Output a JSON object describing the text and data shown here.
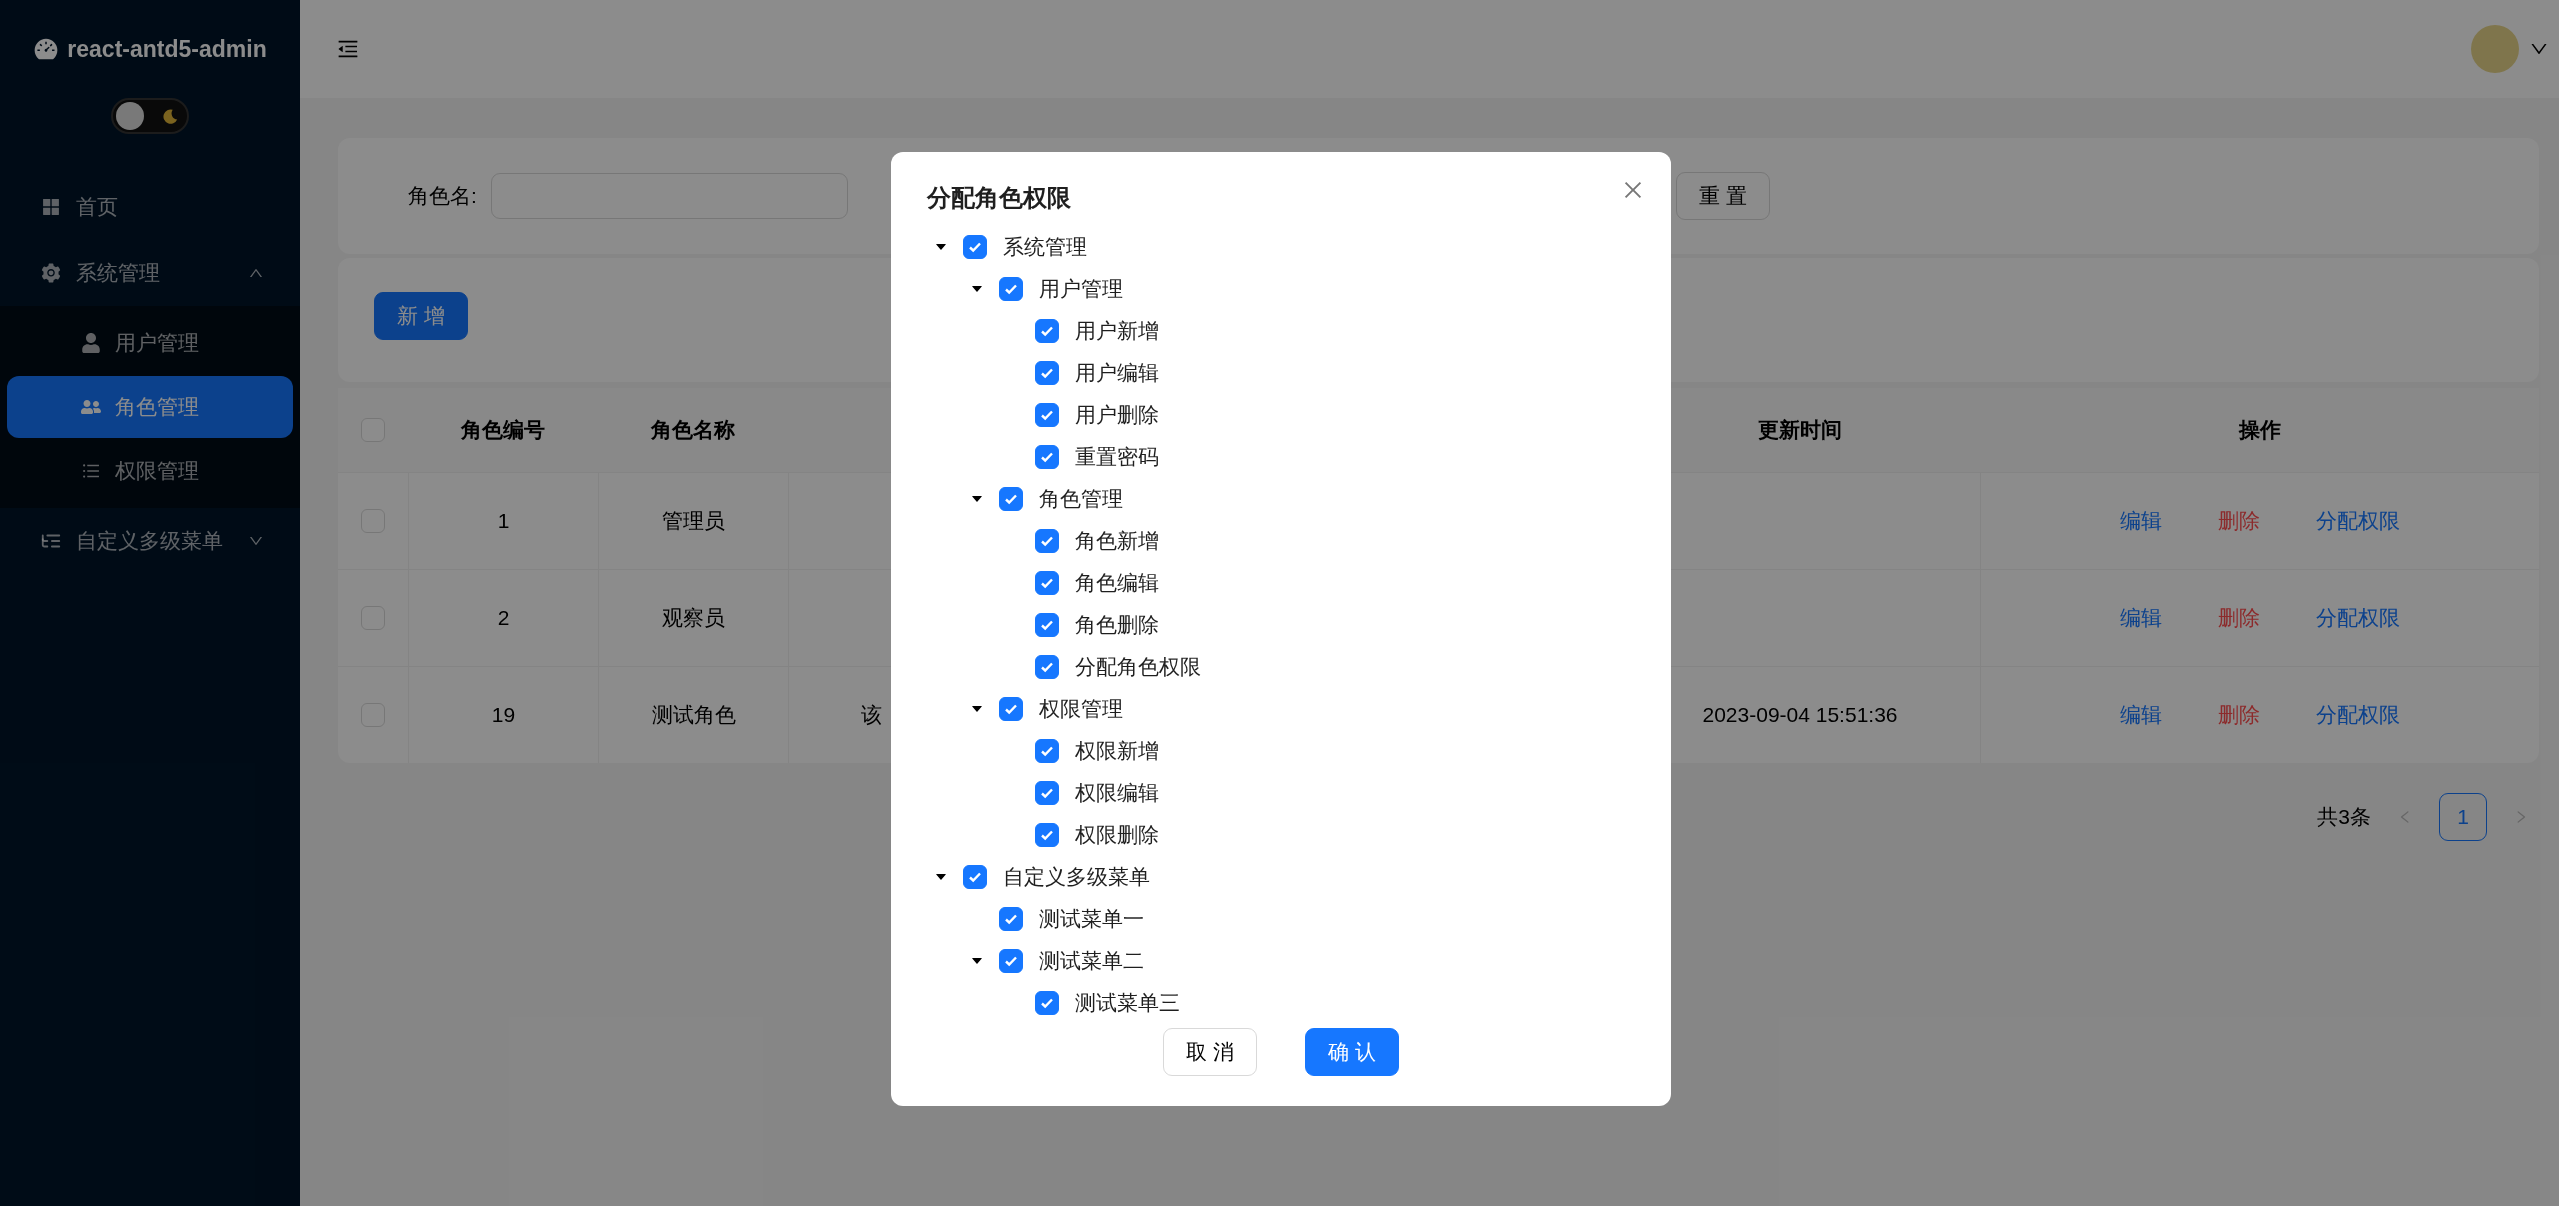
{
  "sidebar": {
    "logo": "react-antd5-admin",
    "theme_switch": {
      "on": false
    },
    "menu": [
      {
        "label": "首页",
        "selected": false
      },
      {
        "label": "系统管理",
        "selected": false,
        "expanded": true,
        "children": [
          {
            "label": "用户管理",
            "selected": false
          },
          {
            "label": "角色管理",
            "selected": true
          },
          {
            "label": "权限管理",
            "selected": false
          }
        ]
      },
      {
        "label": "自定义多级菜单",
        "selected": false,
        "expanded": false
      }
    ]
  },
  "search": {
    "label": "角色名:",
    "reset_button": "重 置"
  },
  "toolbar": {
    "add_button": "新 增"
  },
  "table": {
    "all_checked": false,
    "columns": [
      "角色编号",
      "角色名称",
      "更新时间",
      "操作"
    ],
    "rows": [
      {
        "checked": false,
        "id": "1",
        "name": "管理员",
        "actions": [
          {
            "label": "编辑",
            "kind": "link"
          },
          {
            "label": "删除",
            "kind": "danger"
          },
          {
            "label": "分配权限",
            "kind": "link"
          }
        ]
      },
      {
        "checked": false,
        "id": "2",
        "name": "观察员",
        "actions": [
          {
            "label": "编辑",
            "kind": "link"
          },
          {
            "label": "删除",
            "kind": "danger"
          },
          {
            "label": "分配权限",
            "kind": "link"
          }
        ]
      },
      {
        "checked": false,
        "id": "19",
        "name": "测试角色",
        "column_4": "该",
        "updated": "2023-09-04 15:51:36",
        "actions": [
          {
            "label": "编辑",
            "kind": "link"
          },
          {
            "label": "删除",
            "kind": "danger"
          },
          {
            "label": "分配权限",
            "kind": "link"
          }
        ]
      }
    ]
  },
  "pagination": {
    "total": "共3条",
    "pages": [
      {
        "label": "1",
        "selected": true
      }
    ]
  },
  "modal": {
    "title": "分配角色权限",
    "tree": [
      {
        "label": "系统管理",
        "checked": true,
        "expanded": true,
        "children": [
          {
            "label": "用户管理",
            "checked": true,
            "expanded": true,
            "children": [
              {
                "label": "用户新增",
                "checked": true
              },
              {
                "label": "用户编辑",
                "checked": true
              },
              {
                "label": "用户删除",
                "checked": true
              },
              {
                "label": "重置密码",
                "checked": true
              }
            ]
          },
          {
            "label": "角色管理",
            "checked": true,
            "expanded": true,
            "children": [
              {
                "label": "角色新增",
                "checked": true
              },
              {
                "label": "角色编辑",
                "checked": true
              },
              {
                "label": "角色删除",
                "checked": true
              },
              {
                "label": "分配角色权限",
                "checked": true
              }
            ]
          },
          {
            "label": "权限管理",
            "checked": true,
            "expanded": true,
            "children": [
              {
                "label": "权限新增",
                "checked": true
              },
              {
                "label": "权限编辑",
                "checked": true
              },
              {
                "label": "权限删除",
                "checked": true
              }
            ]
          }
        ]
      },
      {
        "label": "自定义多级菜单",
        "checked": true,
        "expanded": true,
        "children": [
          {
            "label": "测试菜单一",
            "checked": true
          },
          {
            "label": "测试菜单二",
            "checked": true,
            "expanded": true,
            "children": [
              {
                "label": "测试菜单三",
                "checked": true
              }
            ]
          }
        ]
      }
    ],
    "cancel_button": "取 消",
    "ok_button": "确 认"
  }
}
